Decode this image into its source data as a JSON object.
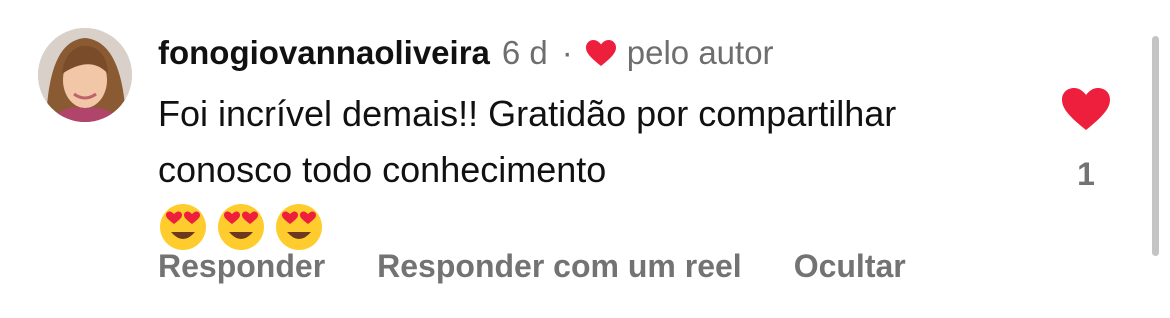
{
  "comment": {
    "username": "fonogiovannaoliveira",
    "time": "6 d",
    "separator": "·",
    "liked_by_author": "pelo autor",
    "text": "Foi incrível demais!! Gratidão por compartilhar conosco todo conhecimento",
    "emojis": [
      "heart-eyes-emoji",
      "heart-eyes-emoji",
      "heart-eyes-emoji"
    ],
    "like_count": "1"
  },
  "actions": {
    "reply": "Responder",
    "reply_reel": "Responder com um reel",
    "hide": "Ocultar"
  },
  "colors": {
    "heart": "#ed1f3c",
    "meta_gray": "#737373",
    "emoji_face": "#ffcc2d"
  }
}
